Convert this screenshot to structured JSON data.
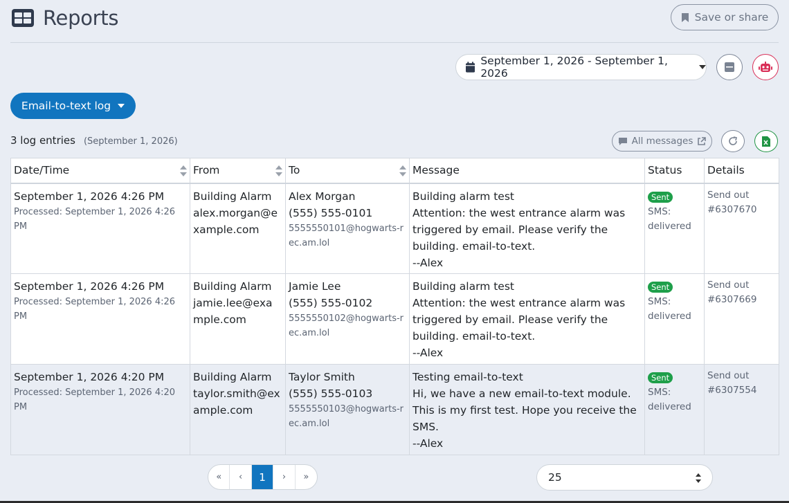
{
  "header": {
    "title": "Reports",
    "save_share_label": "Save or share"
  },
  "date_range": {
    "label": "September 1, 2026 - September 1, 2026"
  },
  "report_type": {
    "label": "Email-to-text log"
  },
  "summary": {
    "count_label": "3 log entries",
    "date_label": "(September 1, 2026)"
  },
  "toolbar": {
    "all_messages_label": "All messages"
  },
  "table": {
    "columns": [
      "Date/Time",
      "From",
      "To",
      "Message",
      "Status",
      "Details"
    ],
    "rows": [
      {
        "datetime": "September 1, 2026 4:26 PM",
        "processed": "Processed: September 1, 2026 4:26 PM",
        "from_name": "Building Alarm",
        "from_email": "alex.morgan@example.com",
        "to_name": "Alex Morgan",
        "to_phone": "(555) 555-0101",
        "to_email": "5555550101@hogwarts-rec.am.lol",
        "message_subject": "Building alarm test",
        "message_body": "Attention: the west entrance alarm was triggered by email. Please verify the building. email-to-text.",
        "message_sign": "--Alex",
        "status_badge": "Sent",
        "status_text": "SMS: delivered",
        "details": "Send out #6307670"
      },
      {
        "datetime": "September 1, 2026 4:26 PM",
        "processed": "Processed: September 1, 2026 4:26 PM",
        "from_name": "Building Alarm",
        "from_email": "jamie.lee@example.com",
        "to_name": "Jamie Lee",
        "to_phone": "(555) 555-0102",
        "to_email": "5555550102@hogwarts-rec.am.lol",
        "message_subject": "Building alarm test",
        "message_body": "Attention: the west entrance alarm was triggered by email. Please verify the building. email-to-text.",
        "message_sign": "--Alex",
        "status_badge": "Sent",
        "status_text": "SMS: delivered",
        "details": "Send out #6307669"
      },
      {
        "datetime": "September 1, 2026 4:20 PM",
        "processed": "Processed: September 1, 2026 4:20 PM",
        "from_name": "Building Alarm",
        "from_email": "taylor.smith@example.com",
        "to_name": "Taylor Smith",
        "to_phone": "(555) 555-0103",
        "to_email": "5555550103@hogwarts-rec.am.lol",
        "message_subject": "Testing email-to-text",
        "message_body": "Hi, we have a new email-to-text module. This is my first test. Hope you receive the SMS.",
        "message_sign": "--Alex",
        "status_badge": "Sent",
        "status_text": "SMS: delivered",
        "details": "Send out #6307554"
      }
    ]
  },
  "pagination": {
    "first": "«",
    "prev": "‹",
    "current": "1",
    "next": "›",
    "last": "»"
  },
  "per_page": {
    "value": "25"
  },
  "colors": {
    "accent": "#1175bf",
    "success": "#1e9f4a",
    "danger": "#d92f58",
    "excel": "#1f9443"
  }
}
